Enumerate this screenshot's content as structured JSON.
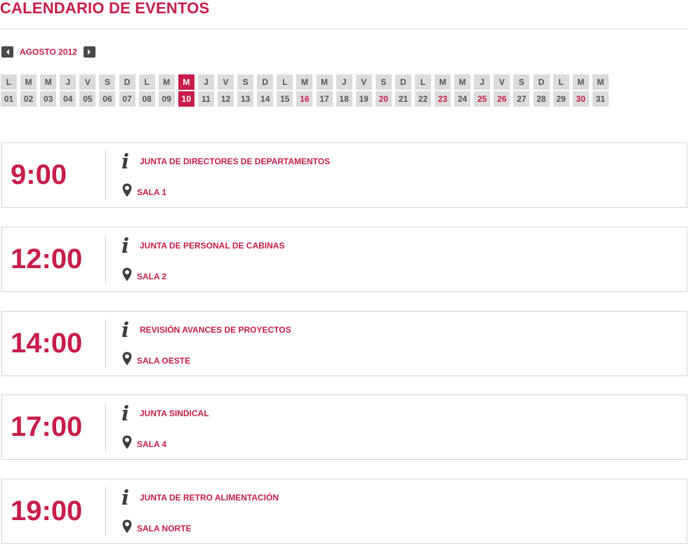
{
  "header": {
    "title": "CALENDARIO DE EVENTOS"
  },
  "month_nav": {
    "label": "AGOSTO 2012"
  },
  "calendar": {
    "day_letters": [
      "L",
      "M",
      "M",
      "J",
      "V",
      "S",
      "D",
      "L",
      "M",
      "M",
      "J",
      "V",
      "S",
      "D",
      "L",
      "M",
      "M",
      "J",
      "V",
      "S",
      "D",
      "L",
      "M",
      "M",
      "J",
      "V",
      "S",
      "D",
      "L",
      "M",
      "M"
    ],
    "day_numbers": [
      "01",
      "02",
      "03",
      "04",
      "05",
      "06",
      "07",
      "08",
      "09",
      "10",
      "11",
      "12",
      "13",
      "14",
      "15",
      "16",
      "17",
      "18",
      "19",
      "20",
      "21",
      "22",
      "23",
      "24",
      "25",
      "26",
      "27",
      "28",
      "29",
      "30",
      "31"
    ],
    "selected_day": "10",
    "highlighted_days": [
      "16",
      "20",
      "23",
      "25",
      "26",
      "30"
    ]
  },
  "events": [
    {
      "time": "9:00",
      "title": "JUNTA DE DIRECTORES DE DEPARTAMENTOS",
      "room": "SALA 1"
    },
    {
      "time": "12:00",
      "title": "JUNTA DE PERSONAL DE CABINAS",
      "room": "SALA 2"
    },
    {
      "time": "14:00",
      "title": "REVISIÓN AVANCES DE PROYECTOS",
      "room": "SALA OESTE"
    },
    {
      "time": "17:00",
      "title": "JUNTA SINDICAL",
      "room": "SALA 4"
    },
    {
      "time": "19:00",
      "title": "JUNTA DE RETRO ALIMENTACIÓN",
      "room": "SALA NORTE"
    }
  ],
  "icons": {
    "prev": "chevron-left-icon",
    "next": "chevron-right-icon",
    "info": "info-icon",
    "location": "map-pin-icon"
  },
  "colors": {
    "accent": "#c71d4b",
    "cell_bg": "#dcdcdc",
    "cell_text": "#555555",
    "nav_button": "#4a4a4a",
    "border": "#d4d4d4"
  }
}
